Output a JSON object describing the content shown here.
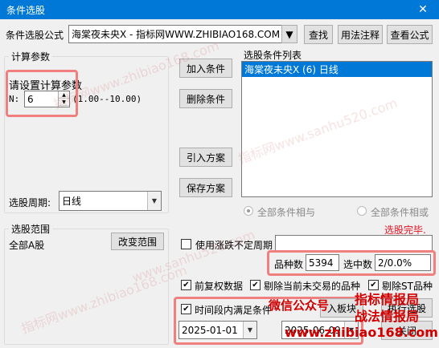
{
  "window": {
    "title": "条件选股",
    "close_glyph": "✕"
  },
  "formula": {
    "label": "条件选股公式",
    "value": "海棠夜未央X  - 指标网WWW.ZHIBIAO168.COM",
    "find_btn": "查找",
    "usage_btn": "用法注释",
    "view_btn": "查看公式"
  },
  "params": {
    "group_label": "计算参数",
    "prompt": "请设置计算参数",
    "n_label": "N:",
    "n_value": "6",
    "range_text": "(1.00--10.00)"
  },
  "period": {
    "label": "选股周期:",
    "value": "日线"
  },
  "scope": {
    "group_label": "选股范围",
    "value": "全部A股",
    "change_btn": "改变范围"
  },
  "actions": {
    "add_cond": "加入条件",
    "del_cond": "删除条件",
    "import_plan": "引入方案",
    "save_plan": "保存方案"
  },
  "condlist": {
    "label": "选股条件列表",
    "items": [
      "海棠夜未央X (6) 日线"
    ]
  },
  "logic": {
    "and_label": "全部条件相与",
    "or_label": "全部条件相或"
  },
  "status": {
    "done_text": "选股完毕."
  },
  "options": {
    "uncertain_period": "使用涨跌不定周期",
    "adjust": "前复权数据",
    "exclude_no_trade": "剔除当前未交易的品种",
    "exclude_st": "剔除ST品种",
    "time_range": "时间段内满足条件"
  },
  "stats": {
    "total_label": "品种数",
    "total_value": "5394",
    "selected_label": "选中数",
    "selected_value": "2/0.0%"
  },
  "dates": {
    "start": "2025-01-01",
    "end": "2025-06-09"
  },
  "bottom": {
    "board_btn": "入板块",
    "run_btn": "执行选股",
    "close_btn": "关闭"
  },
  "overlay": {
    "wechat": "微信公众号",
    "brand1": "指标情报局",
    "brand2": "战法情报局",
    "site": "www.zhibiao168.com"
  },
  "watermarks": [
    "指标网www.zhibiao168.com",
    "指标网www.sanhu520.com",
    "www.sanhu520.com",
    "指标网www.zhibiao168.com"
  ],
  "colors": {
    "titlebar": "#0078d7",
    "status_red": "#e81123",
    "ad_red": "#d00000",
    "highlight_box": "#f08080"
  }
}
